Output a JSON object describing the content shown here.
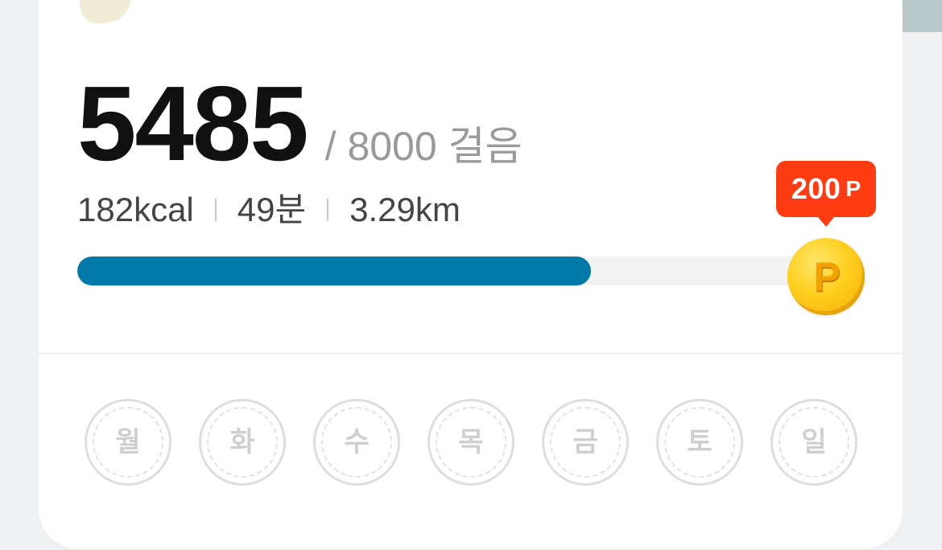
{
  "steps": {
    "current": "5485",
    "goal_text": "/ 8000 걸음",
    "progress_fraction": 0.6856
  },
  "stats": {
    "calories": "182kcal",
    "duration": "49분",
    "distance": "3.29km"
  },
  "reward": {
    "amount": "200",
    "unit": "P",
    "coin_glyph": "P",
    "coin_icon": "point-coin-icon"
  },
  "weekdays": [
    "월",
    "화",
    "수",
    "목",
    "금",
    "토",
    "일"
  ],
  "colors": {
    "progress_fill": "#0078a8",
    "progress_track": "#f3f3f3",
    "reward_badge": "#ff3b12",
    "coin": "#ffcf1f"
  }
}
